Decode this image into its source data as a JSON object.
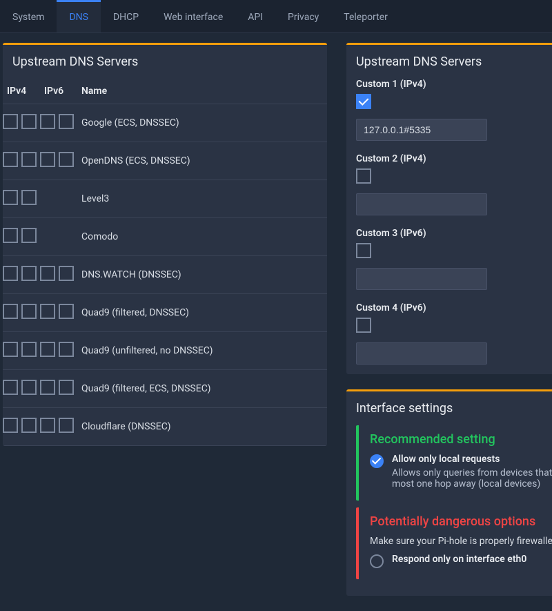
{
  "tabs": [
    "System",
    "DNS",
    "DHCP",
    "Web interface",
    "API",
    "Privacy",
    "Teleporter"
  ],
  "active_tab": 1,
  "left_panel": {
    "title": "Upstream DNS Servers",
    "headers": {
      "ipv4": "IPv4",
      "ipv6": "IPv6",
      "name": "Name"
    },
    "providers": [
      {
        "name": "Google (ECS, DNSSEC)",
        "ipv4_slots": 2,
        "ipv6_slots": 2
      },
      {
        "name": "OpenDNS (ECS, DNSSEC)",
        "ipv4_slots": 2,
        "ipv6_slots": 2
      },
      {
        "name": "Level3",
        "ipv4_slots": 2,
        "ipv6_slots": 0
      },
      {
        "name": "Comodo",
        "ipv4_slots": 2,
        "ipv6_slots": 0
      },
      {
        "name": "DNS.WATCH (DNSSEC)",
        "ipv4_slots": 2,
        "ipv6_slots": 2
      },
      {
        "name": "Quad9 (filtered, DNSSEC)",
        "ipv4_slots": 2,
        "ipv6_slots": 2
      },
      {
        "name": "Quad9 (unfiltered, no DNSSEC)",
        "ipv4_slots": 2,
        "ipv6_slots": 2
      },
      {
        "name": "Quad9 (filtered, ECS, DNSSEC)",
        "ipv4_slots": 2,
        "ipv6_slots": 2
      },
      {
        "name": "Cloudflare (DNSSEC)",
        "ipv4_slots": 2,
        "ipv6_slots": 2
      }
    ]
  },
  "right_panel_custom": {
    "title": "Upstream DNS Servers",
    "items": [
      {
        "label": "Custom 1 (IPv4)",
        "checked": true,
        "value": "127.0.0.1#5335"
      },
      {
        "label": "Custom 2 (IPv4)",
        "checked": false,
        "value": ""
      },
      {
        "label": "Custom 3 (IPv6)",
        "checked": false,
        "value": ""
      },
      {
        "label": "Custom 4 (IPv6)",
        "checked": false,
        "value": ""
      }
    ]
  },
  "interface": {
    "title": "Interface settings",
    "recommended": {
      "heading": "Recommended setting",
      "option_label": "Allow only local requests",
      "option_desc": "Allows only queries from devices that are at most one hop away (local devices)"
    },
    "dangerous": {
      "heading": "Potentially dangerous options",
      "warn": "Make sure your Pi-hole is properly firewalled!",
      "option_label": "Respond only on interface eth0"
    }
  }
}
